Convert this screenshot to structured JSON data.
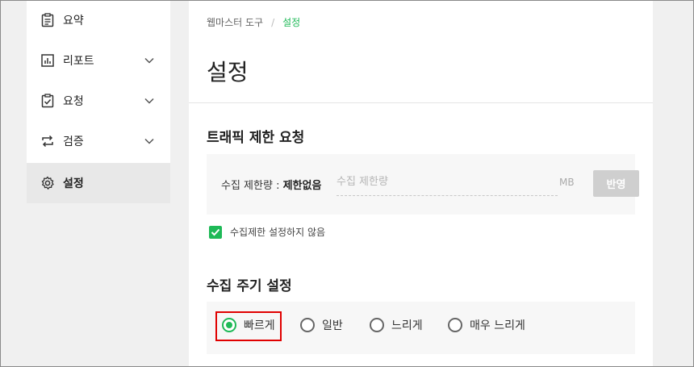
{
  "sidebar": {
    "items": [
      {
        "label": "요약",
        "icon": "clipboard-icon",
        "expandable": false,
        "active": false
      },
      {
        "label": "리포트",
        "icon": "bar-chart-icon",
        "expandable": true,
        "active": false
      },
      {
        "label": "요청",
        "icon": "clipboard-check-icon",
        "expandable": true,
        "active": false
      },
      {
        "label": "검증",
        "icon": "repeat-arrows-icon",
        "expandable": true,
        "active": false
      },
      {
        "label": "설정",
        "icon": "gear-icon",
        "expandable": false,
        "active": true
      }
    ]
  },
  "breadcrumb": {
    "parent": "웹마스터 도구",
    "separator": "/",
    "current": "설정"
  },
  "page": {
    "title": "설정"
  },
  "traffic": {
    "section_title": "트래픽 제한 요청",
    "limit_label": "수집 제한량 : ",
    "limit_value": "제한없음",
    "input_placeholder": "수집 제한량",
    "input_value": "",
    "unit": "MB",
    "apply_label": "반영",
    "checkbox_label": "수집제한 설정하지 않음",
    "checkbox_checked": true
  },
  "crawl": {
    "section_title": "수집 주기 설정",
    "options": [
      {
        "label": "빠르게",
        "checked": true
      },
      {
        "label": "일반",
        "checked": false
      },
      {
        "label": "느리게",
        "checked": false
      },
      {
        "label": "매우 느리게",
        "checked": false
      }
    ]
  },
  "colors": {
    "accent": "#1eb957",
    "highlight": "#e00000",
    "active_bg": "#e8e8e8"
  }
}
